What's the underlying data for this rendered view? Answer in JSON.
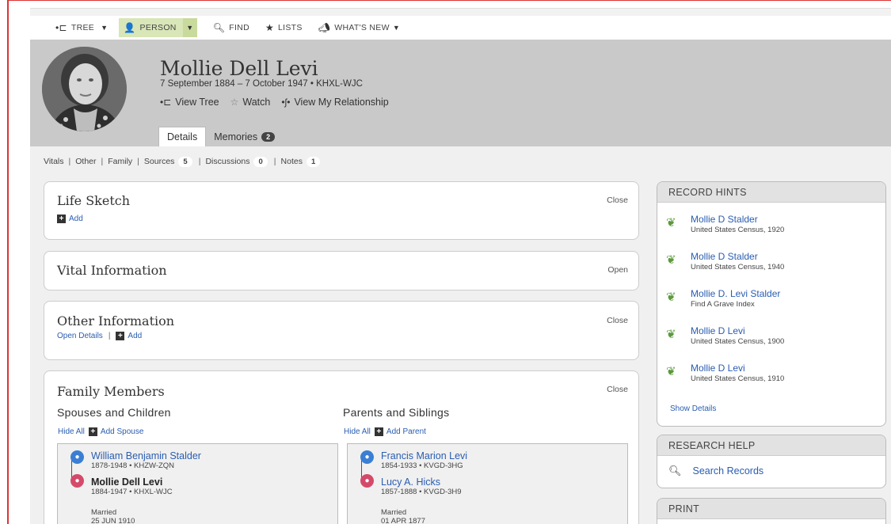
{
  "nav": {
    "tree": "TREE",
    "person": "PERSON",
    "find": "FIND",
    "lists": "LISTS",
    "whats_new": "WHAT'S NEW"
  },
  "header": {
    "name": "Mollie Dell Levi",
    "dates": "7 September 1884 – 7 October 1947 • KHXL-WJC",
    "view_tree": "View Tree",
    "watch": "Watch",
    "view_relationship": "View My Relationship",
    "tabs": [
      {
        "label": "Details"
      },
      {
        "label": "Memories",
        "count": "2"
      }
    ]
  },
  "subnav": {
    "vitals": "Vitals",
    "other": "Other",
    "family": "Family",
    "sources": "Sources",
    "sources_count": "5",
    "discussions": "Discussions",
    "discussions_count": "0",
    "notes": "Notes",
    "notes_count": "1"
  },
  "life_sketch": {
    "title": "Life Sketch",
    "toggle": "Close",
    "add": "Add"
  },
  "vital_info": {
    "title": "Vital Information",
    "toggle": "Open"
  },
  "other_info": {
    "title": "Other Information",
    "toggle": "Close",
    "open_details": "Open Details",
    "add": "Add"
  },
  "family": {
    "title": "Family Members",
    "toggle": "Close",
    "spouses": {
      "title": "Spouses and Children",
      "hide_all": "Hide All",
      "add": "Add Spouse",
      "husband": {
        "name": "William Benjamin Stalder",
        "meta": "1878-1948 • KHZW-ZQN"
      },
      "wife": {
        "name": "Mollie Dell Levi",
        "meta": "1884-1947 • KHXL-WJC"
      },
      "married_label": "Married",
      "married_date": "25 JUN 1910"
    },
    "parents": {
      "title": "Parents and Siblings",
      "hide_all": "Hide All",
      "add": "Add Parent",
      "father": {
        "name": "Francis Marion Levi",
        "meta": "1854-1933 • KVGD-3HG"
      },
      "mother": {
        "name": "Lucy A. Hicks",
        "meta": "1857-1888 • KVGD-3H9"
      },
      "married_label": "Married",
      "married_date": "01 APR 1877"
    }
  },
  "record_hints": {
    "title": "RECORD HINTS",
    "items": [
      {
        "name": "Mollie D Stalder",
        "source": "United States Census, 1920"
      },
      {
        "name": "Mollie D Stalder",
        "source": "United States Census, 1940"
      },
      {
        "name": "Mollie D. Levi Stalder",
        "source": "Find A Grave Index"
      },
      {
        "name": "Mollie D Levi",
        "source": "United States Census, 1900"
      },
      {
        "name": "Mollie D Levi",
        "source": "United States Census, 1910"
      }
    ],
    "show_details": "Show Details"
  },
  "research_help": {
    "title": "RESEARCH HELP",
    "search": "Search Records"
  },
  "print": {
    "title": "PRINT"
  }
}
